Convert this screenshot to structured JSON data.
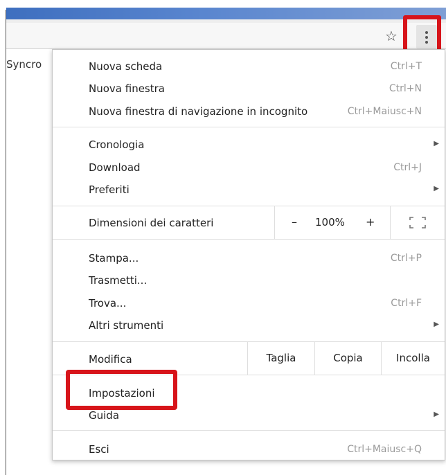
{
  "bookmarks": {
    "syncro_label": "Syncro"
  },
  "toolbar": {
    "star_glyph": "☆"
  },
  "menu": {
    "groups": [
      [
        {
          "label": "Nuova scheda",
          "shortcut": "Ctrl+T"
        },
        {
          "label": "Nuova finestra",
          "shortcut": "Ctrl+N"
        },
        {
          "label": "Nuova finestra di navigazione in incognito",
          "shortcut": "Ctrl+Maiusc+N"
        }
      ],
      [
        {
          "label": "Cronologia",
          "arrow": "▶"
        },
        {
          "label": "Download",
          "shortcut": "Ctrl+J"
        },
        {
          "label": "Preferiti",
          "arrow": "▶"
        }
      ],
      [
        {
          "label": "Stampa...",
          "shortcut": "Ctrl+P"
        },
        {
          "label": "Trasmetti..."
        },
        {
          "label": "Trova...",
          "shortcut": "Ctrl+F"
        },
        {
          "label": "Altri strumenti",
          "arrow": "▶"
        }
      ],
      [
        {
          "label": "Impostazioni"
        },
        {
          "label": "Guida",
          "arrow": "▶"
        }
      ],
      [
        {
          "label": "Esci",
          "shortcut": "Ctrl+Maiusc+Q"
        }
      ]
    ],
    "zoom": {
      "label": "Dimensioni dei caratteri",
      "minus": "–",
      "value": "100%",
      "plus": "+"
    },
    "edit": {
      "label": "Modifica",
      "cut": "Taglia",
      "copy": "Copia",
      "paste": "Incolla"
    }
  },
  "colors": {
    "highlight": "#d7141a",
    "title_bar": "#3e6fbf"
  }
}
